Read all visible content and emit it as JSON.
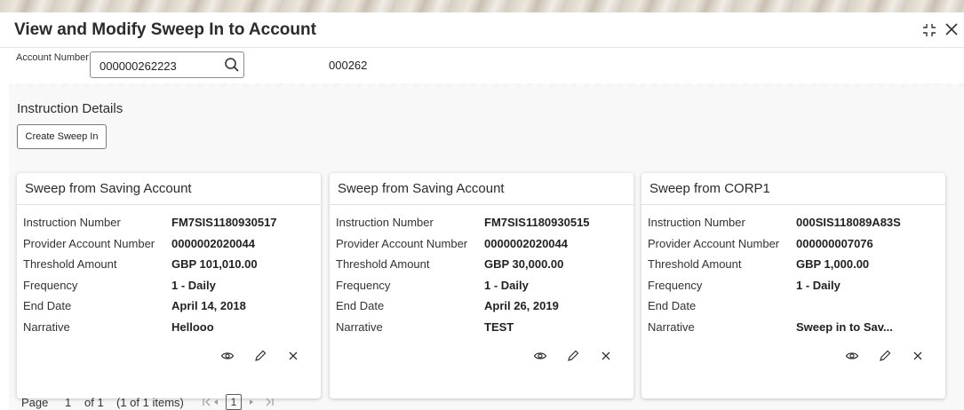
{
  "window": {
    "title": "View and Modify Sweep In to Account"
  },
  "account": {
    "label": "Account Number",
    "value": "000000262223",
    "branch_code": "000262"
  },
  "section": {
    "title": "Instruction Details",
    "create_button": "Create Sweep In"
  },
  "cards": [
    {
      "title": "Sweep from Saving Account",
      "rows": [
        {
          "label": "Instruction Number",
          "value": "FM7SIS1180930517"
        },
        {
          "label": "Provider Account Number",
          "value": "0000002020044"
        },
        {
          "label": "Threshold Amount",
          "value": "GBP 101,010.00"
        },
        {
          "label": "Frequency",
          "value": "1 - Daily"
        },
        {
          "label": "End Date",
          "value": "April 14, 2018"
        },
        {
          "label": "Narrative",
          "value": "Hellooo"
        }
      ]
    },
    {
      "title": "Sweep from Saving Account",
      "rows": [
        {
          "label": "Instruction Number",
          "value": "FM7SIS1180930515"
        },
        {
          "label": "Provider Account Number",
          "value": "0000002020044"
        },
        {
          "label": "Threshold Amount",
          "value": "GBP 30,000.00"
        },
        {
          "label": "Frequency",
          "value": "1 - Daily"
        },
        {
          "label": "End Date",
          "value": "April 26, 2019"
        },
        {
          "label": "Narrative",
          "value": "TEST"
        }
      ]
    },
    {
      "title": "Sweep from CORP1",
      "rows": [
        {
          "label": "Instruction Number",
          "value": "000SIS118089A83S"
        },
        {
          "label": "Provider Account Number",
          "value": "000000007076"
        },
        {
          "label": "Threshold Amount",
          "value": "GBP 1,000.00"
        },
        {
          "label": "Frequency",
          "value": "1 - Daily"
        },
        {
          "label": "End Date",
          "value": ""
        },
        {
          "label": "Narrative",
          "value": "Sweep in to Sav..."
        }
      ]
    }
  ],
  "icons": {
    "view": "eye-icon",
    "edit": "pencil-icon",
    "delete": "close-icon",
    "search": "search-icon",
    "minimize": "minimize-icon",
    "close": "close-icon"
  },
  "pager": {
    "page_label": "Page",
    "page_number": "1",
    "of_total": "of 1",
    "items_summary": "(1 of 1 items)",
    "current": "1"
  },
  "colors": {
    "text": "#2c2c2c",
    "border": "#8c8c8c",
    "section_bg": "#f8f8f8"
  }
}
